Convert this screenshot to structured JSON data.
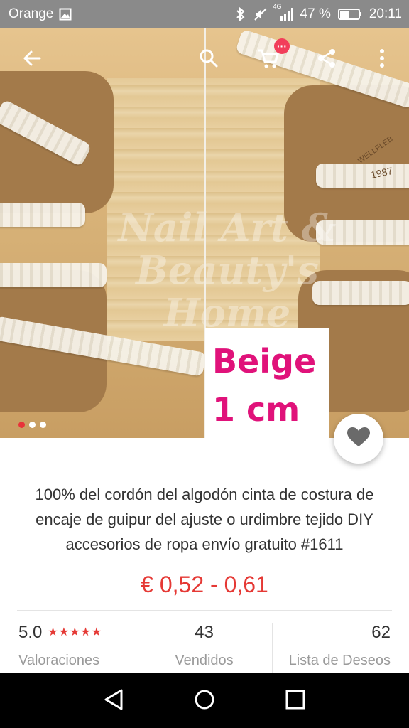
{
  "status_bar": {
    "carrier": "Orange",
    "network": "4G",
    "battery": "47 %",
    "time": "20:11"
  },
  "product_image": {
    "label_line1": "Beige",
    "label_line2": "1 cm",
    "watermark_line1": "Nail Art &",
    "watermark_line2": "Beauty's Home",
    "card_text_1": "1987",
    "card_text_2": "WELLFLEB",
    "slide_count": 3,
    "active_slide": 0
  },
  "top_bar": {
    "cart_badge": "···"
  },
  "product": {
    "title": "100% del cordón del algodón cinta de costura de encaje de guipur del ajuste o urdimbre tejido DIY accesorios de ropa envío gratuito #1611",
    "price": "€ 0,52 - 0,61"
  },
  "stats": {
    "rating_value": "5.0",
    "rating_stars": "★★★★★",
    "rating_label": "Valoraciones",
    "sold_value": "43",
    "sold_label": "Vendidos",
    "wishlist_value": "62",
    "wishlist_label": "Lista de Deseos"
  },
  "colors": {
    "accent_red": "#e53935",
    "label_pink": "#e0127a",
    "status_bar_bg": "#8a8a8a"
  },
  "icons": {
    "back": "arrow-left-icon",
    "search": "search-icon",
    "cart": "cart-icon",
    "share": "share-icon",
    "more": "more-vertical-icon",
    "wishlist": "heart-icon"
  }
}
